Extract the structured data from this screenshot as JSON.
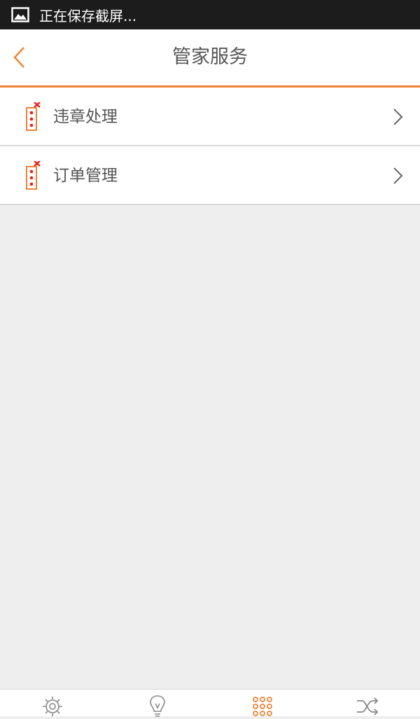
{
  "status_bar": {
    "notification_icon": "image-icon",
    "text": "正在保存截屏..."
  },
  "header": {
    "title": "管家服务",
    "back_icon": "chevron-left-icon"
  },
  "menu": {
    "items": [
      {
        "label": "违章处理",
        "icon": "traffic-light-icon"
      },
      {
        "label": "订单管理",
        "icon": "traffic-light-icon"
      }
    ]
  },
  "tab_bar": {
    "items": [
      {
        "icon": "gear-icon",
        "active": false
      },
      {
        "icon": "lightbulb-icon",
        "active": false
      },
      {
        "icon": "grid-dots-icon",
        "active": true
      },
      {
        "icon": "shuffle-icon",
        "active": false
      }
    ]
  },
  "colors": {
    "accent": "#f08236",
    "badge_red": "#e8201a",
    "text": "#555555",
    "background": "#eeeeee",
    "status_bar": "#1c1c1c"
  }
}
